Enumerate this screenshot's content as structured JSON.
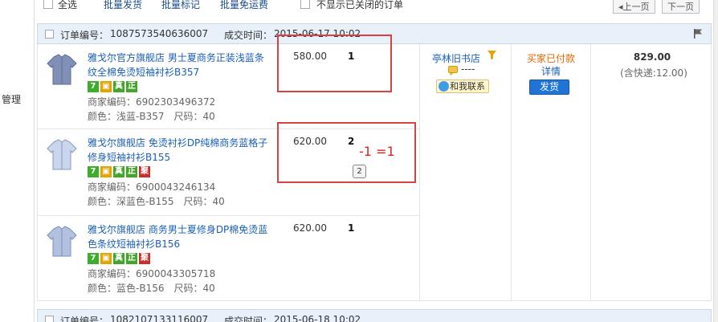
{
  "sidebar": {
    "label": "管理"
  },
  "toolbar": {
    "select_all": "全选",
    "batch_ship": "批量发货",
    "batch_mark": "批量标记",
    "batch_free_shipping": "批量免运费",
    "hide_closed": "不显示已关闭的订单",
    "prev_page": "上一页",
    "next_page": "下一页"
  },
  "order": {
    "number_label": "订单编号：",
    "number": "1087573540636007",
    "time_label": "成交时间：",
    "time": "2015-06-17 10:02",
    "items": [
      {
        "title": "雅戈尔官方旗舰店 男士夏商务正装浅蓝条纹全棉免烫短袖衬衫B357",
        "merchant_code": "商家编码：6902303496372",
        "attrs": "颜色：浅蓝-B357　尺码：40",
        "price": "580.00",
        "qty": "1",
        "badges": [
          "7",
          "bag",
          "真",
          "正"
        ]
      },
      {
        "title": "雅戈尔旗舰店 免烫衬衫DP纯棉商务蓝格子修身短袖衬衫B155",
        "merchant_code": "商家编码：6900043246134",
        "attrs": "颜色：深蓝色-B155　尺码：40",
        "price": "620.00",
        "qty": "2",
        "qty_stepper": "2",
        "badges": [
          "7",
          "bag",
          "真",
          "正",
          "聚"
        ]
      },
      {
        "title": "雅戈尔旗舰店 商务男士夏修身DP棉免烫蓝色条纹短袖衬衫B156",
        "merchant_code": "商家编码：6900043305718",
        "attrs": "颜色：蓝色-B156　尺码：40",
        "price": "620.00",
        "qty": "1",
        "badges": [
          "7",
          "bag",
          "真",
          "正",
          "聚"
        ]
      }
    ],
    "buyer": {
      "name": "亭林旧书店",
      "memo": "----",
      "contact": "和我联系"
    },
    "status": {
      "text": "买家已付款",
      "detail": "详情",
      "ship_button": "发货"
    },
    "total": {
      "amount": "829.00",
      "shipping": "(含快递:12.00)"
    }
  },
  "annotation": {
    "text": "-1 =1"
  },
  "next_order": {
    "number_label": "订单编号：",
    "number": "1082107133116007",
    "time_label": "成交时间：",
    "time": "2015-06-18 10:02"
  },
  "colors": {
    "link": "#1a5fb4",
    "status": "#e56500",
    "annotation": "#e02020",
    "ship_button": "#1f74d6"
  }
}
